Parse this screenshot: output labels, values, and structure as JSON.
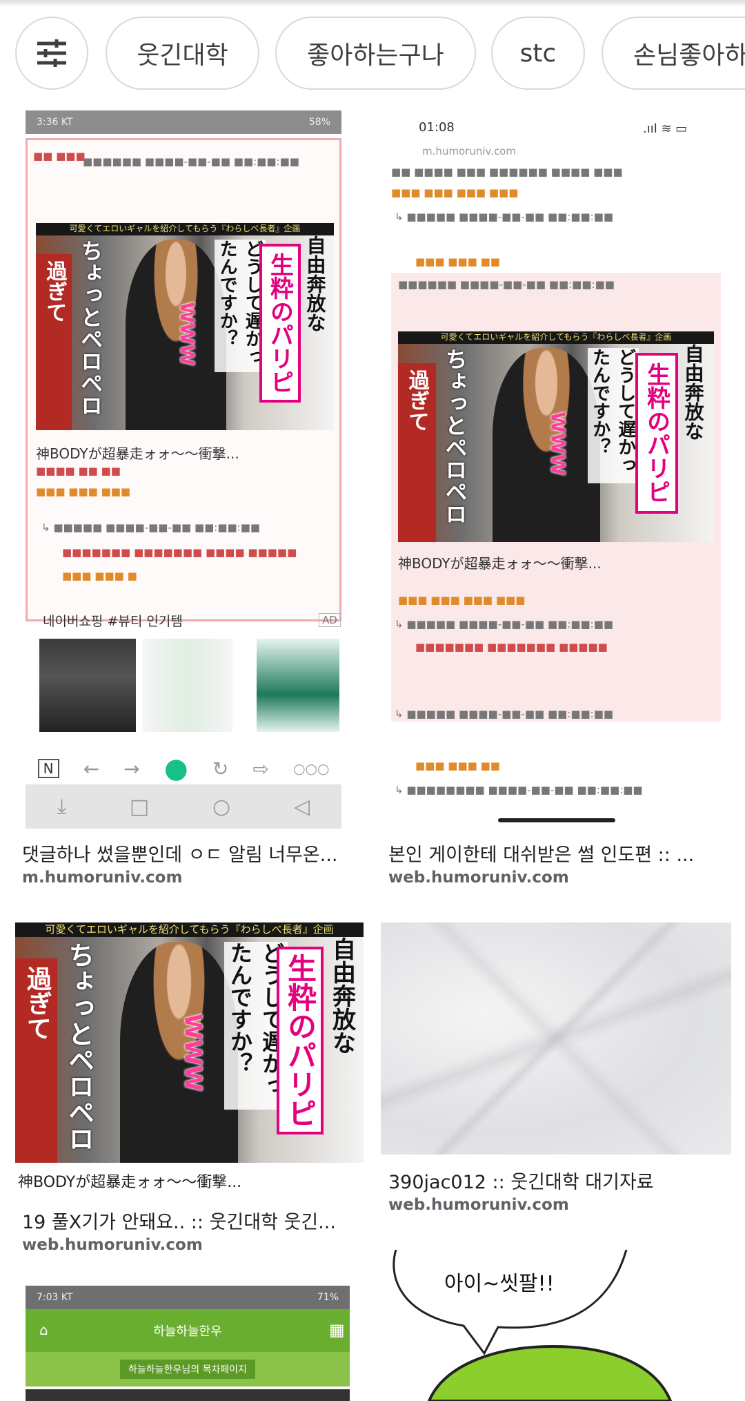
{
  "chips": {
    "filter_icon": "tune-icon",
    "items": [
      "웃긴대학",
      "좋아하는구나",
      "stc",
      "손님좋아하"
    ]
  },
  "results": [
    {
      "title": "댓글하나 썼을뿐인데 ㅇㄷ 알림 너무온...",
      "source": "m.humoruniv.com",
      "shot": {
        "status_left": "3:36 KT",
        "status_right": "58%",
        "caption": "神BODYが超暴走ォォ〜〜衝撃...",
        "ad_label": "네이버쇼핑 #뷰티 인기템",
        "ad_badge": "AD"
      }
    },
    {
      "title": "본인 게이한테 대쉬받은 썰 인도편 :: ...",
      "source": "web.humoruniv.com",
      "shot": {
        "status_left": "01:08",
        "url": "m.humoruniv.com",
        "caption": "神BODYが超暴走ォォ〜〜衝撃..."
      }
    },
    {
      "title": "19 풀X기가 안돼요.. :: 웃긴대학 웃긴...",
      "source": "web.humoruniv.com",
      "caption": "神BODYが超暴走ォォ〜〜衝撃..."
    },
    {
      "title": "390jac012 :: 웃긴대학 대기자료",
      "source": "web.humoruniv.com"
    },
    {
      "shot": {
        "status_left": "7:03 KT",
        "status_right": "71%",
        "header": "하늘하늘한우",
        "subheader": "하늘하늘한우님의 목차페이지"
      }
    },
    {
      "speech": "아이~씻팔!!"
    }
  ],
  "photo_text": {
    "banner": "可愛くてエロいギャルを紹介してもらう『わらしべ長者』企画",
    "col_red": "過ぎて",
    "col_left": "ちょっとペロペロ",
    "col_mid": "どうして遅かったんですか？",
    "col_pink": "生粋のパリピ",
    "col_right": "自由奔放な",
    "www": "WWW"
  },
  "colors": {
    "chip_border": "#d9d9d9",
    "source_text": "#5f6368",
    "title_text": "#202124",
    "accent_pink": "#e4007f",
    "accent_green": "#6aae2f"
  }
}
